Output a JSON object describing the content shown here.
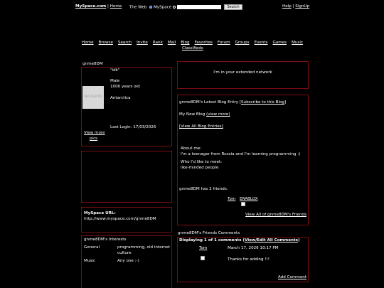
{
  "top_bar": {
    "site": "MySpace.com",
    "sep": "|",
    "home": "Home",
    "search_label": "The Web",
    "search_scope": "MySpace",
    "search_button": "Search",
    "help": "Help",
    "sep2": "|",
    "signup": "SignUp"
  },
  "nav": {
    "items": [
      "Home",
      "Browse",
      "Search",
      "Invite",
      "Rank",
      "Mail",
      "Blog",
      "Favorites",
      "Forum",
      "Groups",
      "Events",
      "Games",
      "Music"
    ],
    "second_row": "Classifieds"
  },
  "profile": {
    "name": "gnme8DM",
    "quote": "\"idk\"",
    "gender": "Male",
    "age": "1000 years old",
    "location": "Antarctica",
    "photo_text": "NO PHOTO",
    "last_login_label": "Last Login:",
    "last_login": "17/03/2026",
    "view_more": "View more",
    "pics": "pics"
  },
  "url_box": {
    "title": "MySpace URL:",
    "url": "http://www.myspace.com/gnme8DM"
  },
  "interests": {
    "title": "gnme8DM's Interests",
    "rows": [
      {
        "label": "General",
        "value1": "programming, old internet",
        "value2": "culture"
      },
      {
        "label": "Music",
        "value1": "Any one :-)",
        "value2": ""
      }
    ]
  },
  "network": {
    "text": "I'm in your extended network"
  },
  "blog": {
    "title_prefix": "gnme8DM's Latest Blog Entry [",
    "subscribe": "Subscribe to this Blog",
    "title_suffix": "]",
    "entry": "My New Blog",
    "view_more": "(view more)",
    "view_all": "[View All Blog Entries]",
    "about_label": "About me:",
    "about_text": "I'm a teenager from Russia and I'm learning programming :)",
    "meet_label": "Who I'd like to meet:",
    "meet_text": "like-minded people"
  },
  "friends": {
    "summary": "gnme8DM has 2 friends.",
    "names": [
      "Tom",
      "ERABLOX"
    ],
    "view_all": "View All of gnme8DM's Friends"
  },
  "comments": {
    "title": "gnme8DM's Friends Comments",
    "displaying_prefix": "Displaying ",
    "count": "1",
    "of_text": " of ",
    "total": "1",
    "comments_word": " comments (",
    "view_edit": "View/Edit All Comments",
    "close_paren": ")",
    "author": "Tom",
    "date": "March 17, 2026 10:17 PM",
    "text": "Thanks for adding !!!",
    "add": "Add Comment"
  }
}
